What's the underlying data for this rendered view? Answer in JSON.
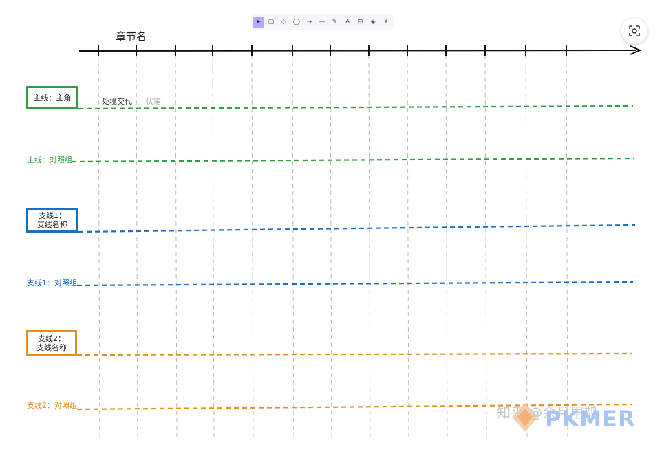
{
  "toolbar": {
    "tools": [
      {
        "icon": "pointer-icon",
        "glyph": "➤",
        "active": true
      },
      {
        "icon": "rectangle-icon",
        "glyph": "▢"
      },
      {
        "icon": "diamond-icon",
        "glyph": "◇"
      },
      {
        "icon": "ellipse-icon",
        "glyph": "◯"
      },
      {
        "icon": "arrow-icon",
        "glyph": "→"
      },
      {
        "icon": "line-icon",
        "glyph": "—"
      },
      {
        "icon": "pencil-icon",
        "glyph": "✎"
      },
      {
        "icon": "text-icon",
        "glyph": "A"
      },
      {
        "icon": "image-icon",
        "glyph": "⊟"
      },
      {
        "icon": "eraser-icon",
        "glyph": "◈"
      },
      {
        "icon": "library-icon",
        "glyph": "⚘"
      }
    ]
  },
  "lens_button": {
    "icon": "lens-search-icon"
  },
  "timeline": {
    "title": "章节名",
    "tick_count": 13
  },
  "rows": [
    {
      "id": "main-line",
      "label": "主线：主角",
      "boxed": true,
      "color": "#2e9e3e"
    },
    {
      "id": "main-control",
      "label": "主线：对照组",
      "boxed": false,
      "color": "#2e9e3e"
    },
    {
      "id": "branch1-line",
      "label_lines": [
        "支线1：",
        "支线名称"
      ],
      "boxed": true,
      "color": "#1a6fbf"
    },
    {
      "id": "branch1-control",
      "label": "支线1：对照组",
      "boxed": false,
      "color": "#1a6fbf"
    },
    {
      "id": "branch2-line",
      "label_lines": [
        "支线2：",
        "支线名称"
      ],
      "boxed": true,
      "color": "#e0901f"
    },
    {
      "id": "branch2-control",
      "label": "支线2：对照组",
      "boxed": false,
      "color": "#e0901f"
    }
  ],
  "cells": {
    "event": "处境交代",
    "foreshadow": "伏笔"
  },
  "watermark": {
    "zhihu": "知乎 @余月里鹊",
    "brand": "PKMER"
  }
}
